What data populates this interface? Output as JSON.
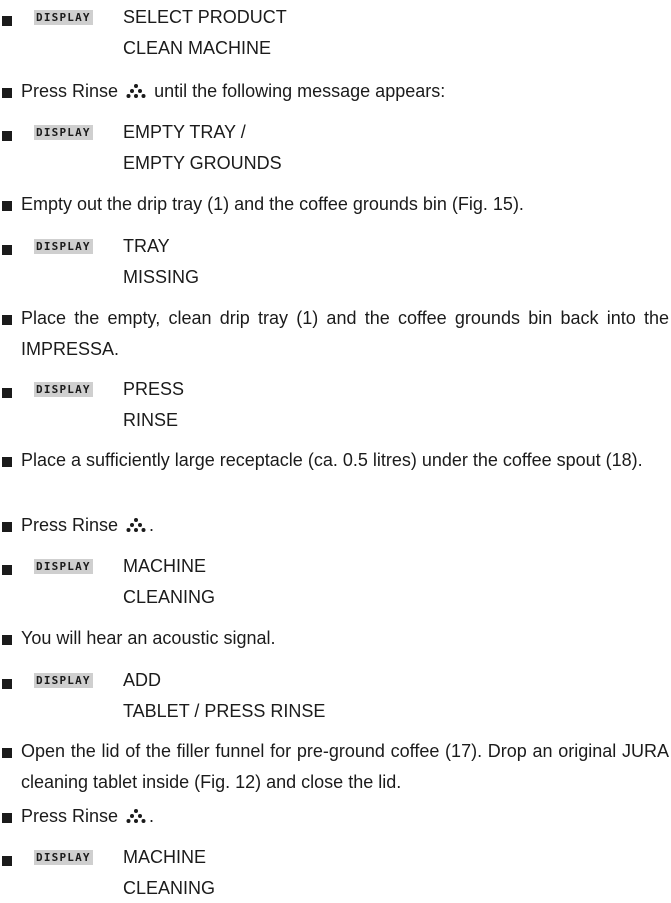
{
  "display_tag": "DISPLAY",
  "items": [
    {
      "kind": "display",
      "line1": "SELECT PRODUCT",
      "line2": "CLEAN MACHINE"
    },
    {
      "kind": "step",
      "before": "Press Rinse",
      "icon": "rinse-icon",
      "after": "until the following message appears:"
    },
    {
      "kind": "display",
      "line1": "EMPTY TRAY /",
      "line2": "EMPTY GROUNDS"
    },
    {
      "kind": "step",
      "text": "Empty out the drip tray (1) and the coffee grounds bin (Fig. 15)."
    },
    {
      "kind": "display",
      "line1": "TRAY",
      "line2": "MISSING"
    },
    {
      "kind": "step",
      "text": "Place the empty, clean drip tray (1) and the coffee grounds bin back into the IMPRESSA."
    },
    {
      "kind": "display",
      "line1": "PRESS",
      "line2": "RINSE"
    },
    {
      "kind": "step",
      "text": "Place a sufficiently large receptacle (ca. 0.5 litres) under the coffee spout (18)."
    },
    {
      "kind": "step",
      "before": "Press Rinse",
      "icon": "rinse-icon",
      "after": "."
    },
    {
      "kind": "display",
      "line1": "MACHINE",
      "line2": "CLEANING"
    },
    {
      "kind": "step",
      "text": "You will hear an acoustic signal."
    },
    {
      "kind": "display",
      "line1": "ADD",
      "line2": "TABLET / PRESS RINSE"
    },
    {
      "kind": "step",
      "text": "Open the lid of the filler funnel for pre-ground coffee (17). Drop an original JURA cleaning tablet inside (Fig. 12) and close the lid."
    },
    {
      "kind": "step",
      "before": "Press Rinse",
      "icon": "rinse-icon",
      "after": "."
    },
    {
      "kind": "display",
      "line1": "MACHINE",
      "line2": "CLEANING"
    }
  ]
}
